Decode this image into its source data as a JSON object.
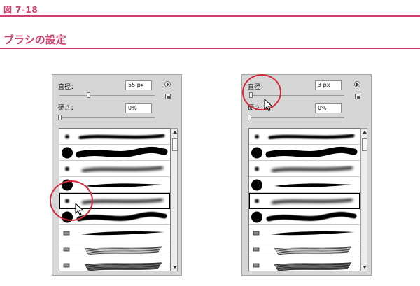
{
  "header": {
    "figure_label": "図 7-18",
    "title": "ブラシの設定"
  },
  "panels": {
    "left": {
      "size_label": "直径：",
      "size_value": "55 px",
      "hardness_label": "硬さ：",
      "hardness_value": "0%",
      "size_slider_level": 0.3
    },
    "right": {
      "size_label": "直径：",
      "size_value": "3 px",
      "hardness_label": "硬さ：",
      "hardness_value": "0%",
      "size_slider_level": 0.0
    }
  },
  "brush_presets": [
    {
      "kind": "soft-round"
    },
    {
      "kind": "hard-round"
    },
    {
      "kind": "soft-round"
    },
    {
      "kind": "hard-round-taper"
    },
    {
      "kind": "soft-round"
    },
    {
      "kind": "hard-round"
    },
    {
      "kind": "leaf"
    },
    {
      "kind": "chalk"
    },
    {
      "kind": "dry-brush"
    }
  ],
  "colors": {
    "accent": "#d0406e",
    "highlight_circle": "#d42a3c"
  }
}
